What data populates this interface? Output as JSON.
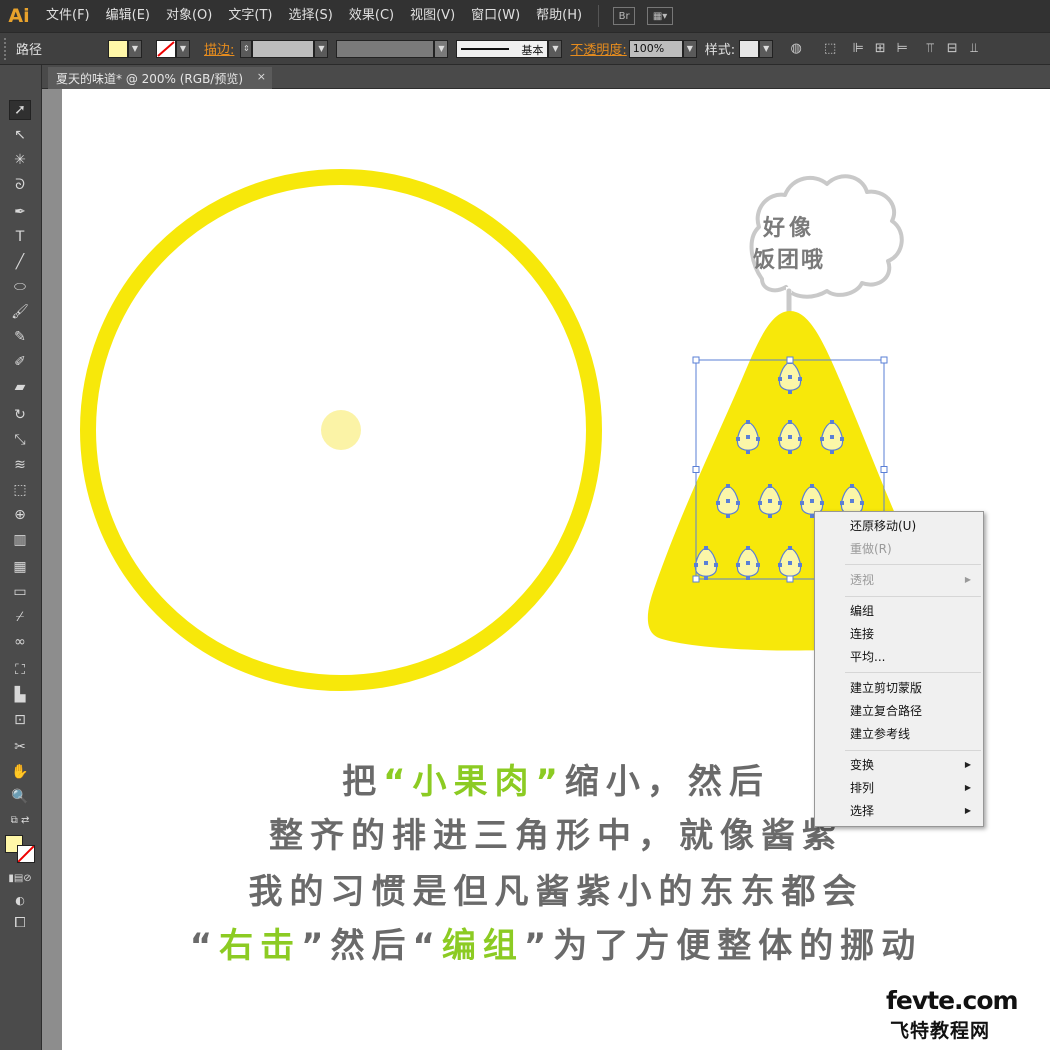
{
  "app": {
    "logo": "Ai"
  },
  "menu": [
    "文件(F)",
    "编辑(E)",
    "对象(O)",
    "文字(T)",
    "选择(S)",
    "效果(C)",
    "视图(V)",
    "窗口(W)",
    "帮助(H)"
  ],
  "menubar_btn": "Br",
  "control": {
    "object_type": "路径",
    "fill_color": "#fff7a8",
    "stroke_label": "描边:",
    "stroke_style": "基本",
    "opacity_label": "不透明度:",
    "opacity_value": "100%",
    "style_label": "样式:"
  },
  "document": {
    "tab_title": "夏天的味道* @ 200% (RGB/预览)",
    "close": "×"
  },
  "artwork": {
    "circle_color": "#f7e80a",
    "dot_color": "#fbf3a6",
    "triangle_color": "#f7e80a",
    "seed_color": "#fbf6a8",
    "selection_color": "#5a7fd6",
    "bubble_text": [
      "好像",
      "饭团哦"
    ]
  },
  "caption": {
    "line1": [
      "把",
      "“",
      "小果肉",
      "”",
      "缩小，然后"
    ],
    "line2": "整齐的排进三角形中，就像酱紫",
    "line3": "我的习惯是但凡酱紫小的东东都会",
    "line4": [
      "“",
      "右击",
      "”",
      "然后",
      "“",
      "编组",
      "”",
      "为了方便整体的挪动"
    ]
  },
  "context_menu": {
    "items": [
      {
        "label": "还原移动(U)",
        "enabled": true,
        "submenu": false
      },
      {
        "label": "重做(R)",
        "enabled": false,
        "submenu": false
      },
      {
        "label": "透视",
        "enabled": false,
        "submenu": true
      },
      {
        "label": "编组",
        "enabled": true,
        "submenu": false
      },
      {
        "label": "连接",
        "enabled": true,
        "submenu": false
      },
      {
        "label": "平均...",
        "enabled": true,
        "submenu": false
      },
      {
        "label": "建立剪切蒙版",
        "enabled": true,
        "submenu": false
      },
      {
        "label": "建立复合路径",
        "enabled": true,
        "submenu": false
      },
      {
        "label": "建立参考线",
        "enabled": true,
        "submenu": false
      },
      {
        "label": "变换",
        "enabled": true,
        "submenu": true
      },
      {
        "label": "排列",
        "enabled": true,
        "submenu": true
      },
      {
        "label": "选择",
        "enabled": true,
        "submenu": true
      }
    ]
  },
  "watermark": {
    "line1": "fevte.com",
    "line2": "飞特教程网"
  }
}
